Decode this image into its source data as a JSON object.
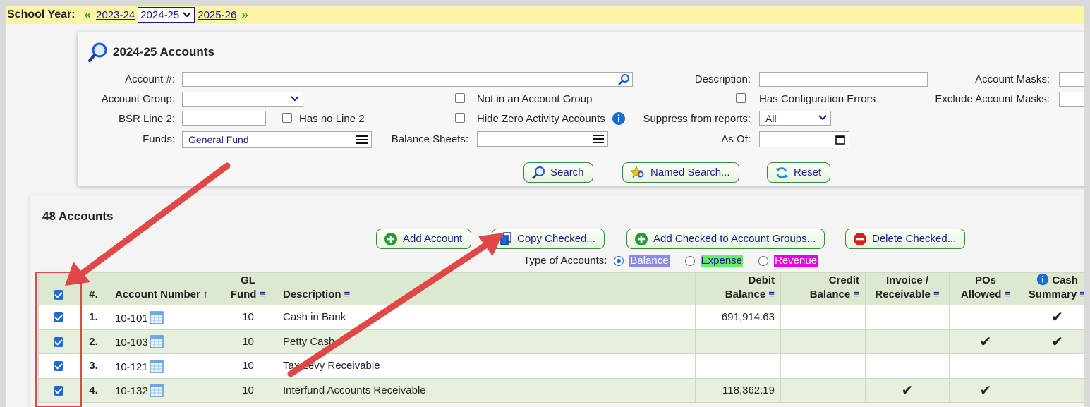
{
  "year_bar": {
    "label": "School Year:",
    "prev_year": "2023-24",
    "current_year": "2024-25",
    "next_year": "2025-26"
  },
  "search_panel": {
    "title": "2024-25 Accounts",
    "account_num_label": "Account #:",
    "account_num_value": "",
    "description_label": "Description:",
    "account_masks_label": "Account Masks:",
    "account_group_label": "Account Group:",
    "not_in_group_label": "Not in an Account Group",
    "has_config_errors_label": "Has Configuration Errors",
    "exclude_masks_label": "Exclude Account Masks:",
    "bsr_line2_label": "BSR Line 2:",
    "has_no_line2_label": "Has no Line 2",
    "hide_zero_label": "Hide Zero Activity Accounts",
    "suppress_label": "Suppress from reports:",
    "suppress_value": "All",
    "funds_label": "Funds:",
    "funds_value": "General Fund",
    "balance_sheets_label": "Balance Sheets:",
    "as_of_label": "As Of:",
    "search_button": "Search",
    "named_search_button": "Named Search...",
    "reset_button": "Reset"
  },
  "accounts": {
    "title": "48 Accounts",
    "add_account_button": "Add Account",
    "copy_checked_button": "Copy Checked...",
    "add_to_groups_button": "Add Checked to Account Groups...",
    "delete_checked_button": "Delete Checked...",
    "type_label": "Type of Accounts:",
    "types": {
      "balance": "Balance",
      "expense": "Expense",
      "revenue": "Revenue"
    },
    "colors": {
      "balance": "#8a8ae8",
      "expense": "#66ee66",
      "revenue": "#e600e6",
      "checkbox": "#1a6ad8",
      "annotation": "#e04848"
    },
    "columns": {
      "num": "#.",
      "account_number": "Account Number",
      "gl_fund_1": "GL",
      "gl_fund_2": "Fund",
      "description": "Description",
      "debit_1": "Debit",
      "debit_2": "Balance",
      "credit_1": "Credit",
      "credit_2": "Balance",
      "invoice_1": "Invoice /",
      "invoice_2": "Receivable",
      "pos_1": "POs",
      "pos_2": "Allowed",
      "cash_1": "Cash",
      "cash_2": "Summary"
    },
    "rows": [
      {
        "num": "1.",
        "account": "10-101",
        "fund": "10",
        "description": "Cash in Bank",
        "debit": "691,914.63",
        "credit": "",
        "invoice": false,
        "pos": false,
        "cash": true
      },
      {
        "num": "2.",
        "account": "10-103",
        "fund": "10",
        "description": "Petty Cash",
        "debit": "",
        "credit": "",
        "invoice": false,
        "pos": true,
        "cash": true
      },
      {
        "num": "3.",
        "account": "10-121",
        "fund": "10",
        "description": "Tax Levy Receivable",
        "debit": "",
        "credit": "",
        "invoice": false,
        "pos": false,
        "cash": false
      },
      {
        "num": "4.",
        "account": "10-132",
        "fund": "10",
        "description": "Interfund Accounts Receivable",
        "debit": "118,362.19",
        "credit": "",
        "invoice": true,
        "pos": true,
        "cash": false
      }
    ]
  }
}
